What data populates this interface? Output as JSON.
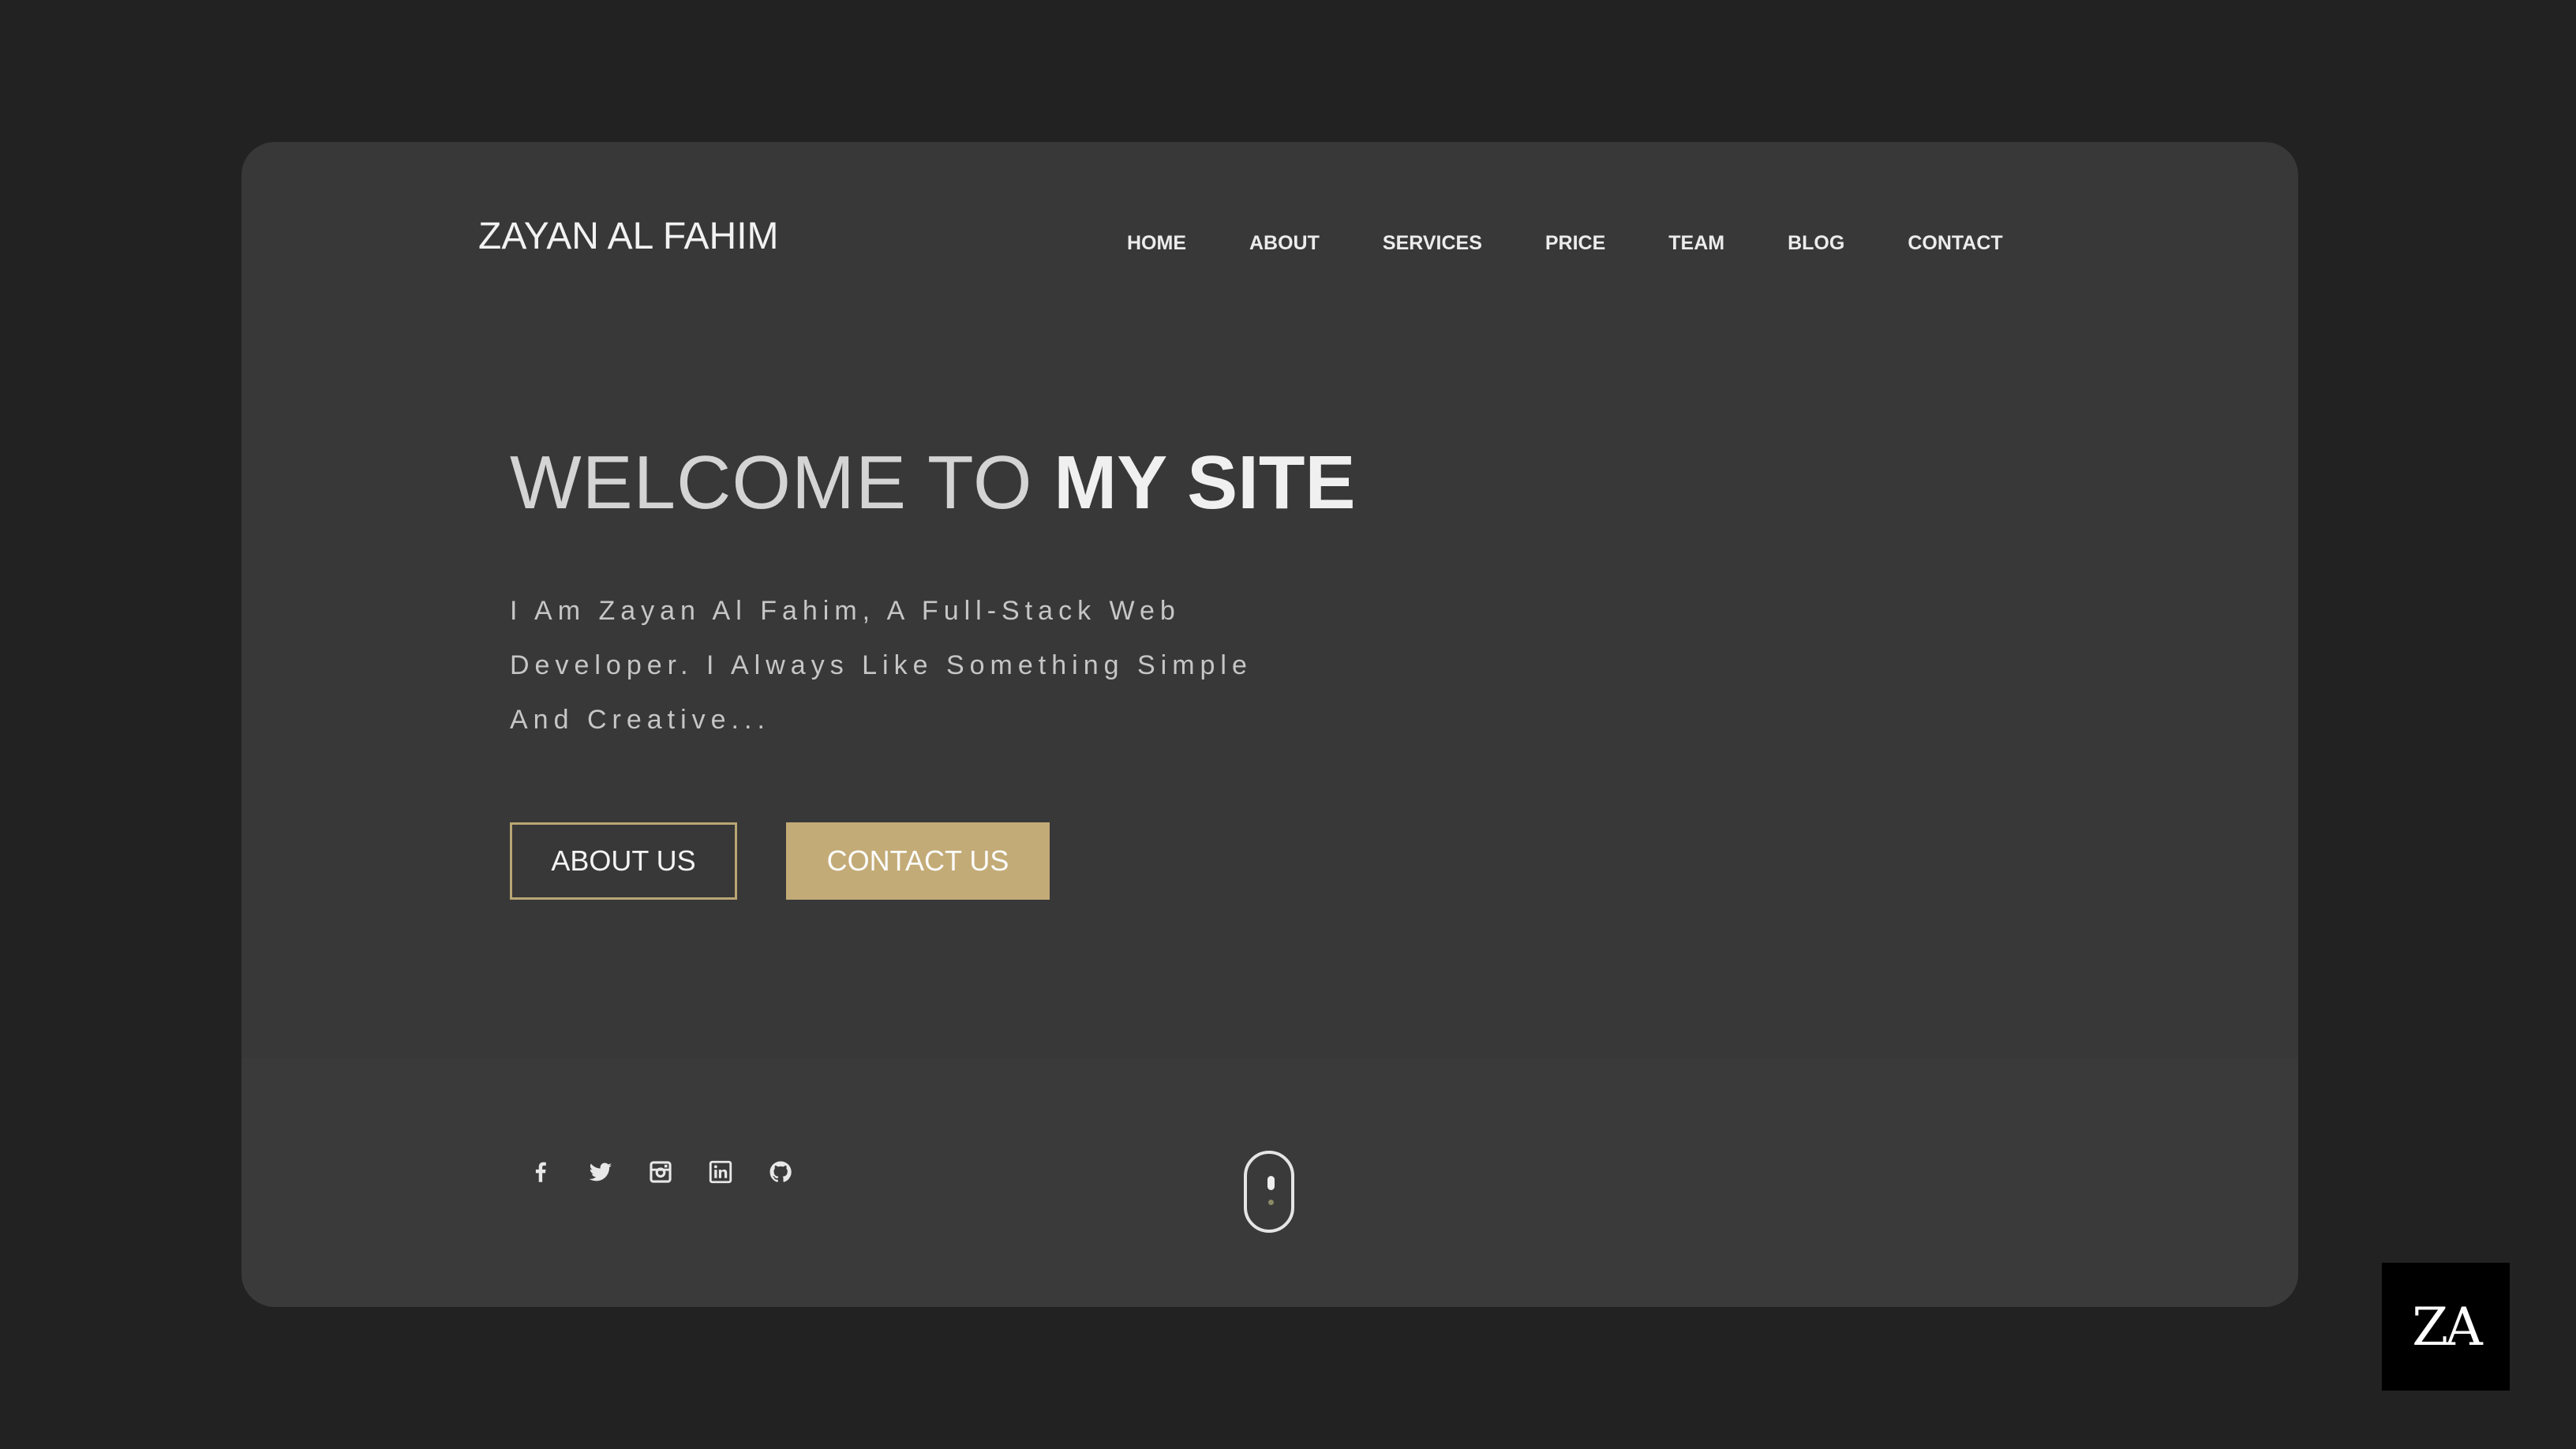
{
  "header": {
    "brand": "ZAYAN AL FAHIM",
    "nav": [
      "HOME",
      "ABOUT",
      "SERVICES",
      "PRICE",
      "TEAM",
      "BLOG",
      "CONTACT"
    ]
  },
  "hero": {
    "title_light": "WELCOME TO",
    "title_bold": "MY SITE",
    "subtitle": "I Am Zayan Al Fahim, A Full-Stack Web Developer. I Always Like Something Simple And Creative...",
    "about_button": "ABOUT US",
    "contact_button": "CONTACT US"
  },
  "socials": [
    {
      "name": "facebook-icon"
    },
    {
      "name": "twitter-icon"
    },
    {
      "name": "instagram-icon"
    },
    {
      "name": "linkedin-icon"
    },
    {
      "name": "github-icon"
    }
  ],
  "watermark": {
    "text": "ZA"
  },
  "colors": {
    "page_background": "#222222",
    "card_background": "#383838",
    "accent": "#c3ab77",
    "text": "#f0f0f0"
  }
}
